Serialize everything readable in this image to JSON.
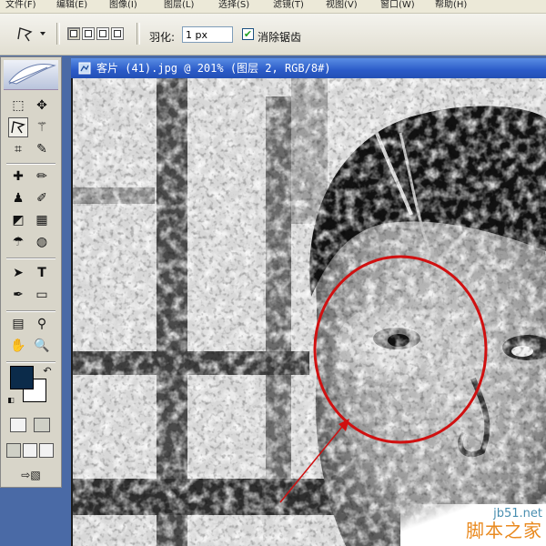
{
  "menubar": {
    "items": [
      "文件(F)",
      "编辑(E)",
      "图像(I)",
      "图层(L)",
      "选择(S)",
      "滤镜(T)",
      "视图(V)",
      "窗口(W)",
      "帮助(H)"
    ]
  },
  "options_bar": {
    "tool_preset_icon": "polygonal-lasso-icon",
    "feather_label": "羽化:",
    "feather_value": "1 px",
    "anti_alias_label": "消除锯齿",
    "anti_alias_checked": true
  },
  "document": {
    "title": "客片 (41).jpg @ 201% (图层 2, RGB/8#)",
    "annotation_color": "#d01010"
  },
  "toolbox": {
    "foreground_color": "#0b2b4a",
    "background_color": "#ffffff",
    "tools": [
      "marquee",
      "move",
      "polygonal-lasso",
      "magic-wand",
      "crop",
      "slice",
      "healing-brush",
      "brush",
      "clone-stamp",
      "history-brush",
      "eraser",
      "gradient",
      "blur",
      "dodge",
      "path-select",
      "type",
      "pen",
      "rectangle",
      "notes",
      "eyedropper",
      "hand",
      "zoom"
    ]
  },
  "watermark": {
    "url": "jb51.net",
    "text": "脚本之家"
  }
}
